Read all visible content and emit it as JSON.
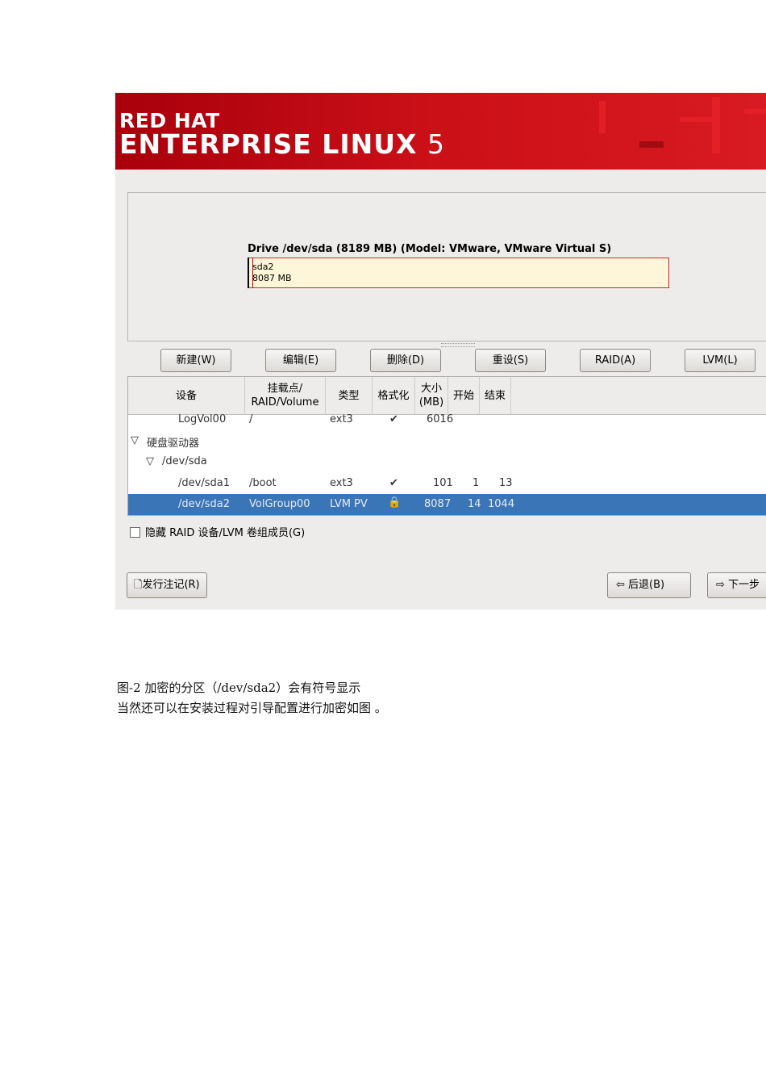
{
  "header": {
    "brand_line1": "RED HAT",
    "brand_line2": "ENTERPRISE LINUX",
    "version": "5"
  },
  "drive": {
    "title": "Drive /dev/sda (8189 MB) (Model: VMware, VMware Virtual S)",
    "partition_name": "sda2",
    "partition_size": "8087 MB"
  },
  "buttons": [
    "新建(W)",
    "编辑(E)",
    "删除(D)",
    "重设(S)",
    "RAID(A)",
    "LVM(L)"
  ],
  "table": {
    "headers": [
      "设备",
      "挂载点/ RAID/Volume",
      "类型",
      "格式化",
      "大小 (MB)",
      "开始",
      "结束"
    ],
    "rows": [
      {
        "device": "LogVol00",
        "mount": "/",
        "type": "ext3",
        "format": "✔",
        "size": "6016",
        "start": "",
        "end": ""
      },
      {
        "device": "硬盘驱动器",
        "group": true
      },
      {
        "device": "/dev/sda",
        "group": true
      },
      {
        "device": "/dev/sda1",
        "mount": "/boot",
        "type": "ext3",
        "format": "✔",
        "size": "101",
        "start": "1",
        "end": "13"
      },
      {
        "device": "/dev/sda2",
        "mount": "VolGroup00",
        "type": "LVM PV",
        "format": "🔒",
        "size": "8087",
        "start": "14",
        "end": "1044",
        "selected": true
      }
    ]
  },
  "hide_checkbox": {
    "label": "隐藏 RAID 设备/LVM 卷组成员(G)",
    "checked": false
  },
  "footer": {
    "release_notes": "发行注记(R)",
    "back": "后退(B)",
    "next": "下一步"
  },
  "caption": {
    "line1": "图-2  加密的分区（/dev/sda2）会有符号显示",
    "line2": "当然还可以在安装过程对引导配置进行加密如图    。"
  }
}
